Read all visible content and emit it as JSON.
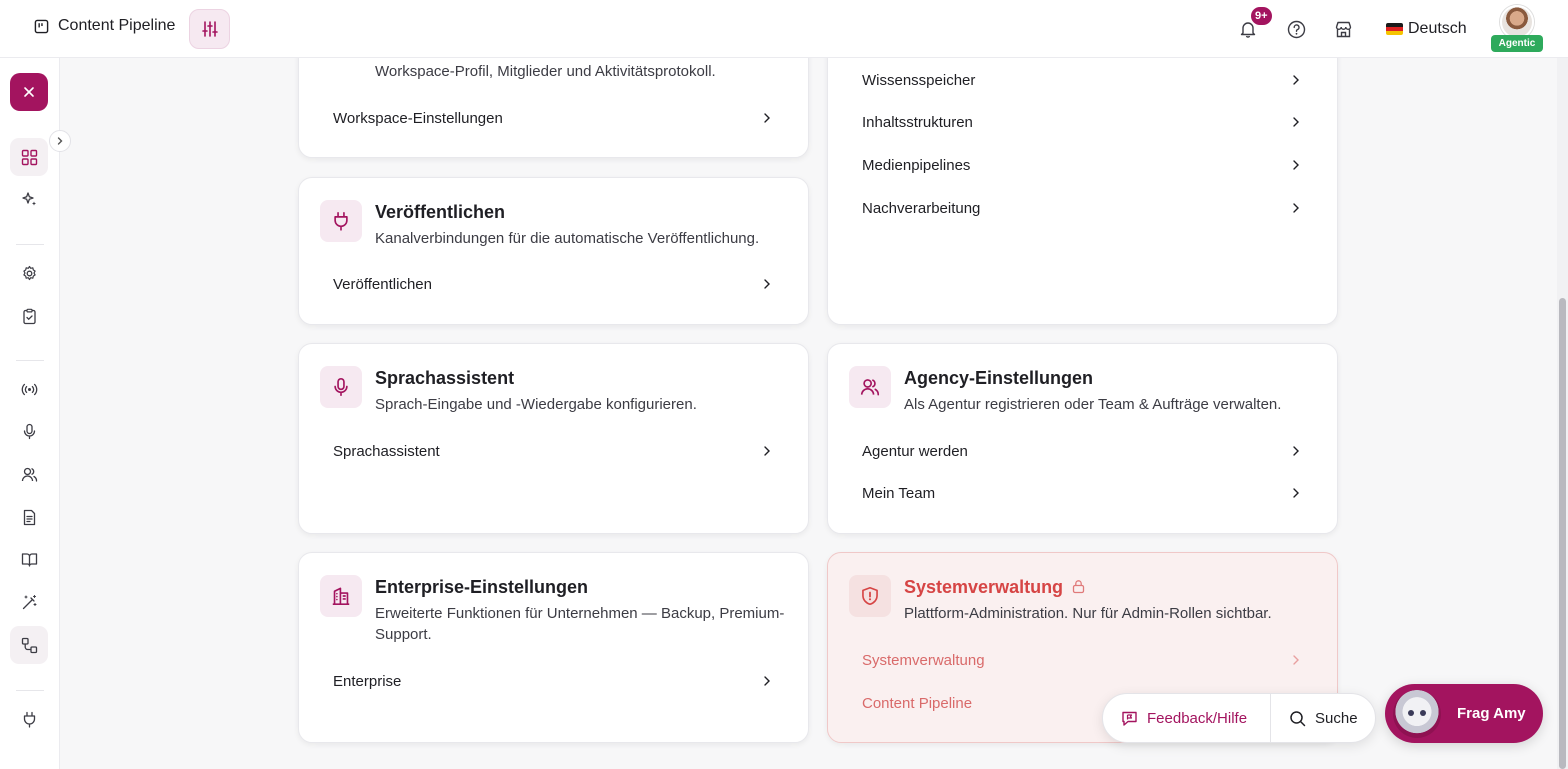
{
  "topbar": {
    "app_title": "Content Pipeline",
    "notification_count": "9+",
    "language": "Deutsch",
    "user_role": "Agentic"
  },
  "cards": {
    "workspace": {
      "description": "Workspace-Profil, Mitglieder und Aktivitätsprotokoll.",
      "links": [
        "Workspace-Einstellungen"
      ]
    },
    "knowledge": {
      "links": [
        "Wissensspeicher",
        "Inhaltsstrukturen",
        "Medienpipelines",
        "Nachverarbeitung"
      ]
    },
    "publish": {
      "title": "Veröffentlichen",
      "description": "Kanalverbindungen für die automatische Veröffentlichung.",
      "links": [
        "Veröffentlichen"
      ]
    },
    "voice": {
      "title": "Sprachassistent",
      "description": "Sprach-Eingabe und -Wiedergabe konfigurieren.",
      "links": [
        "Sprachassistent"
      ]
    },
    "agency": {
      "title": "Agency-Einstellungen",
      "description": "Als Agentur registrieren oder Team & Aufträge verwalten.",
      "links": [
        "Agentur werden",
        "Mein Team"
      ]
    },
    "enterprise": {
      "title": "Enterprise-Einstellungen",
      "description": "Erweiterte Funktionen für Unternehmen — Backup, Premium-Support.",
      "links": [
        "Enterprise"
      ]
    },
    "system": {
      "title": "Systemverwaltung",
      "description": "Plattform-Administration. Nur für Admin-Rollen sichtbar.",
      "links": [
        "Systemverwaltung",
        "Content Pipeline"
      ]
    }
  },
  "floating": {
    "feedback_label": "Feedback/Hilfe",
    "search_label": "Suche",
    "assistant_label": "Frag Amy"
  },
  "colors": {
    "accent": "#a3145f",
    "danger": "#d64545",
    "success": "#2eaa5c"
  }
}
